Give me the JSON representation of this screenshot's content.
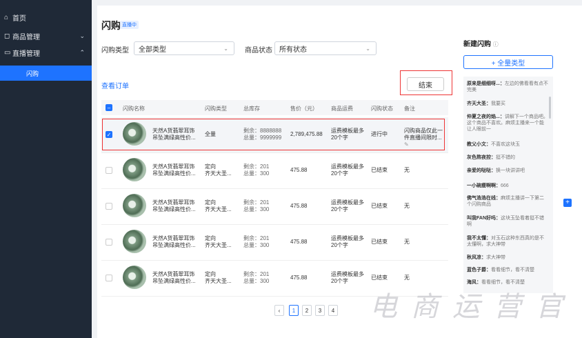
{
  "sidebar": {
    "items": [
      {
        "icon": "home-icon",
        "label": "首页"
      },
      {
        "icon": "shopping-bag-icon",
        "label": "商品管理"
      },
      {
        "icon": "live-icon",
        "label": "直播管理"
      }
    ],
    "sub_active": "闪购"
  },
  "header": {
    "title": "闪购",
    "badge": "直播中"
  },
  "filters": {
    "type_label": "闪购类型",
    "type_value": "全部类型",
    "status_label": "商品状态",
    "status_value": "所有状态"
  },
  "actions": {
    "view_orders": "查看订单",
    "end_button": "结束"
  },
  "table": {
    "headers": [
      "闪购名称",
      "闪购类型",
      "总库存",
      "售价（元）",
      "商品运费",
      "闪购状态",
      "备注"
    ],
    "rows": [
      {
        "name1": "天然A货翡翠耳饰",
        "name2": "吊坠满绿高性价...",
        "type1": "全量",
        "type2": "",
        "stock1": "剩余：8888888",
        "stock2": "总量：9999999",
        "price": "2,789,475.88",
        "ship1": "运费模板最多",
        "ship2": "20个字",
        "status": "进行中",
        "note1": "闪购商品仅此一",
        "note2": "件直播间限时...",
        "selected": true
      },
      {
        "name1": "天然A货翡翠耳饰",
        "name2": "吊坠满绿高性价...",
        "type1": "定向",
        "type2": "齐天大圣...",
        "stock1": "剩余：201",
        "stock2": "总量：300",
        "price": "475.88",
        "ship1": "运费模板最多",
        "ship2": "20个字",
        "status": "已结束",
        "note1": "无",
        "note2": "",
        "selected": false
      },
      {
        "name1": "天然A货翡翠耳饰",
        "name2": "吊坠满绿高性价...",
        "type1": "定向",
        "type2": "齐天大圣...",
        "stock1": "剩余：201",
        "stock2": "总量：300",
        "price": "475.88",
        "ship1": "运费模板最多",
        "ship2": "20个字",
        "status": "已结束",
        "note1": "无",
        "note2": "",
        "selected": false
      },
      {
        "name1": "天然A货翡翠耳饰",
        "name2": "吊坠满绿高性价...",
        "type1": "定向",
        "type2": "齐天大圣...",
        "stock1": "剩余：201",
        "stock2": "总量：300",
        "price": "475.88",
        "ship1": "运费模板最多",
        "ship2": "20个字",
        "status": "已结束",
        "note1": "无",
        "note2": "",
        "selected": false
      },
      {
        "name1": "天然A货翡翠耳饰",
        "name2": "吊坠满绿高性价...",
        "type1": "定向",
        "type2": "齐天大圣...",
        "stock1": "剩余：201",
        "stock2": "总量：300",
        "price": "475.88",
        "ship1": "运费模板最多",
        "ship2": "20个字",
        "status": "已结束",
        "note1": "无",
        "note2": "",
        "selected": false
      }
    ]
  },
  "pagination": {
    "pages": [
      "1",
      "2",
      "3",
      "4"
    ],
    "current": "1"
  },
  "right_panel": {
    "title": "新建闪购",
    "add_button": "+ 全量类型",
    "comments": [
      {
        "user": "原来是细细呀...：",
        "text": "左边的佛看看有点不完美"
      },
      {
        "user": "齐天大圣：",
        "text": "我要买"
      },
      {
        "user": "仲夏之夜的焰...：",
        "text": "讲解下一个商品吧。这个商品不喜欢。麻烦主播来一个能让人眼前一"
      },
      {
        "user": "教父小文：",
        "text": "不喜欢这块玉"
      },
      {
        "user": "灰色熬夜控：",
        "text": "挺不错的"
      },
      {
        "user": "亲爱的哒哒：",
        "text": "换一块讲讲吧"
      },
      {
        "user": "一小碗瘦啊啊：",
        "text": "666"
      },
      {
        "user": "佛气浩浩在线：",
        "text": "麻烦主播讲一下第二个闪购商品"
      },
      {
        "user": "叫我FAN好吗：",
        "text": "这块玉坠看着挺不错啊"
      },
      {
        "user": "我不太懂：",
        "text": "对玉石这种东西真的是不太懂啊，求大神带"
      },
      {
        "user": "秋风凉：",
        "text": "求大神带"
      },
      {
        "user": "蓝色子爵：",
        "text": "看看细节，看不清楚"
      },
      {
        "user": "海风：",
        "text": "看看细节，看不清楚"
      }
    ]
  },
  "watermark": "电商运营官"
}
